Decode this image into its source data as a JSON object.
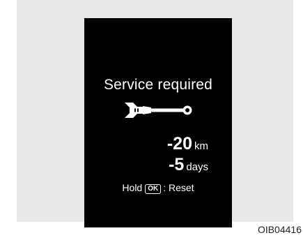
{
  "display": {
    "title": "Service required",
    "icon": "wrench-icon",
    "distance": {
      "value": "-20",
      "unit": "km"
    },
    "time": {
      "value": "-5",
      "unit": "days"
    },
    "reset_hint": {
      "prefix": "Hold",
      "key": "OK",
      "suffix": ": Reset"
    }
  },
  "figure_code": "OIB04416",
  "colors": {
    "screen_background": "#000000",
    "screen_text": "#ffffff",
    "frame_background": "#e9e9e9"
  }
}
